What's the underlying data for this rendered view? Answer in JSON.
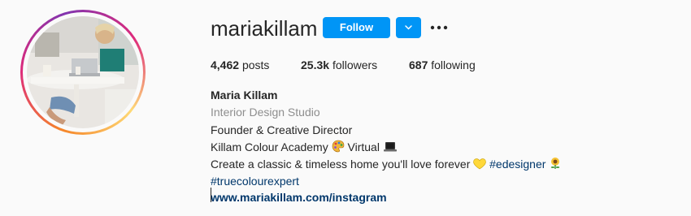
{
  "profile": {
    "username": "mariakillam",
    "follow_label": "Follow",
    "dropdown_icon": "chevron-down-icon",
    "more_icon": "more-options-icon"
  },
  "stats": {
    "posts_count": "4,462",
    "posts_label": "posts",
    "followers_count": "25.3k",
    "followers_label": "followers",
    "following_count": "687",
    "following_label": "following"
  },
  "bio": {
    "full_name": "Maria Killam",
    "category": "Interior Design Studio",
    "line1": "Founder & Creative Director",
    "line2_text": "Killam Colour Academy",
    "line2_suffix": "Virtual",
    "line3_text": "Create a classic & timeless home you'll love forever",
    "hashtag1": "#edesigner",
    "hashtag2": "#truecolourexpert",
    "website": "www.mariakillam.com/instagram"
  },
  "colors": {
    "accent": "#0095f6",
    "link": "#00376b",
    "muted": "#8e8e8e",
    "text": "#262626",
    "background": "#fafafa"
  }
}
